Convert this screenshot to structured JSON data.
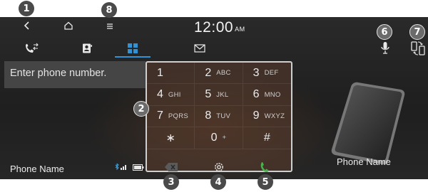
{
  "header": {
    "back_icon": "back-icon",
    "home_icon": "home-icon",
    "menu_icon": "menu-icon",
    "clock_time": "12:00",
    "clock_ampm": "AM"
  },
  "tabs": [
    {
      "name": "recent-calls",
      "icon": "call-history-icon",
      "active": false
    },
    {
      "name": "contacts",
      "icon": "contacts-icon",
      "active": false
    },
    {
      "name": "dial-pad",
      "icon": "dialpad-icon",
      "active": true
    },
    {
      "name": "messages",
      "icon": "message-icon",
      "active": false
    }
  ],
  "right_icons": [
    "microphone-icon",
    "switch-phone-icon"
  ],
  "number_field": {
    "placeholder": "Enter phone number."
  },
  "keypad": [
    {
      "digit": "1",
      "letters": ""
    },
    {
      "digit": "2",
      "letters": "ABC"
    },
    {
      "digit": "3",
      "letters": "DEF"
    },
    {
      "digit": "4",
      "letters": "GHI"
    },
    {
      "digit": "5",
      "letters": "JKL"
    },
    {
      "digit": "6",
      "letters": "MNO"
    },
    {
      "digit": "7",
      "letters": "PQRS"
    },
    {
      "digit": "8",
      "letters": "TUV"
    },
    {
      "digit": "9",
      "letters": "WXYZ"
    },
    {
      "digit": "∗",
      "letters": ""
    },
    {
      "digit": "0",
      "letters": "+"
    },
    {
      "digit": "#",
      "letters": ""
    }
  ],
  "bottom": {
    "phone_name_left": "Phone Name",
    "phone_name_right": "Phone Name",
    "delete_icon": "backspace-icon",
    "settings_icon": "settings-icon",
    "call_icon": "call-icon"
  },
  "callouts": [
    "1",
    "2",
    "3",
    "4",
    "5",
    "6",
    "7",
    "8"
  ],
  "colors": {
    "accent": "#2f93d6",
    "call_green": "#4caf50",
    "callout_bg": "#4a4a4a"
  }
}
